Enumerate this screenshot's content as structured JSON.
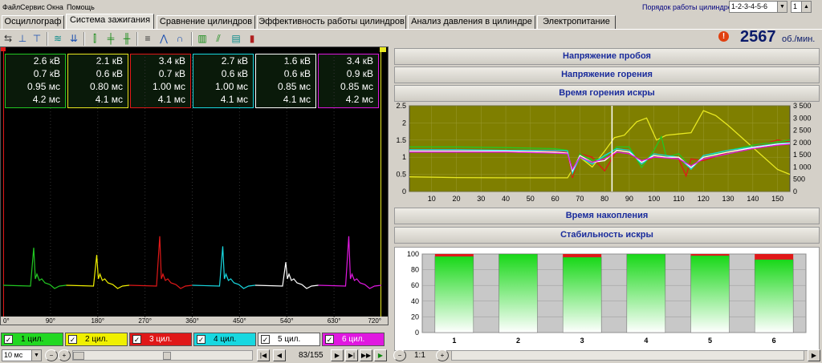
{
  "menu": [
    "Файл",
    "Сервис",
    "Окна",
    "Помощь"
  ],
  "firing_order": {
    "label": "Порядок работы цилиндров",
    "value": "1-2-3-4-5-6",
    "index": "1"
  },
  "tabs": [
    "Осциллограф",
    "Система зажигания",
    "Сравнение цилиндров",
    "Эффективность работы цилиндров",
    "Анализ давления в цилиндре",
    "Электропитание"
  ],
  "rpm": {
    "value": "2567",
    "unit": "об./мин."
  },
  "cylinders": [
    {
      "kv1": "2.6 кВ",
      "kv2": "0.7 кВ",
      "ms1": "0.95 мс",
      "ms2": "4.2 мс",
      "label": "1 цил.",
      "color": "#22c822"
    },
    {
      "kv1": "2.1 кВ",
      "kv2": "0.6 кВ",
      "ms1": "0.80 мс",
      "ms2": "4.1 мс",
      "label": "2 цил.",
      "color": "#f0f000"
    },
    {
      "kv1": "3.4 кВ",
      "kv2": "0.7 кВ",
      "ms1": "1.00 мс",
      "ms2": "4.1 мс",
      "label": "3 цил.",
      "color": "#e01818"
    },
    {
      "kv1": "2.7 кВ",
      "kv2": "0.6 кВ",
      "ms1": "1.00 мс",
      "ms2": "4.1 мс",
      "label": "4 цил.",
      "color": "#18d8e0"
    },
    {
      "kv1": "1.6 кВ",
      "kv2": "0.6 кВ",
      "ms1": "0.85 мс",
      "ms2": "4.1 мс",
      "label": "5 цил.",
      "color": "#ffffff"
    },
    {
      "kv1": "3.4 кВ",
      "kv2": "0.9 кВ",
      "ms1": "0.85 мс",
      "ms2": "4.2 мс",
      "label": "6 цил.",
      "color": "#e018e0"
    }
  ],
  "scope_axis": [
    "0°",
    "90°",
    "180°",
    "270°",
    "360°",
    "450°",
    "540°",
    "630°",
    "720°"
  ],
  "timebase": "10 мс",
  "frame": "83/155",
  "sections": [
    "Напряжение пробоя",
    "Напряжение горения",
    "Время горения искры",
    "Время накопления",
    "Стабильность искры"
  ],
  "zoom": "1:1",
  "chart_data": [
    {
      "type": "line",
      "y_left_ticks": [
        "0",
        "0.5",
        "1",
        "1.5",
        "2",
        "2.5"
      ],
      "y_right_ticks": [
        "0",
        "500",
        "1 000",
        "1 500",
        "2 000",
        "2 500",
        "3 000",
        "3 500"
      ],
      "x_ticks": [
        "10",
        "20",
        "30",
        "40",
        "50",
        "60",
        "70",
        "80",
        "90",
        "100",
        "110",
        "120",
        "130",
        "140",
        "150"
      ],
      "xlim": [
        1,
        155
      ],
      "ylim_left": [
        0,
        2.5
      ],
      "ylim_right": [
        0,
        3500
      ],
      "cursor_x": 83,
      "series": [
        {
          "color": "#e8e820",
          "axis": "right",
          "x": [
            1,
            20,
            40,
            60,
            65,
            70,
            75,
            80,
            84,
            88,
            93,
            97,
            101,
            105,
            110,
            115,
            120,
            125,
            130,
            140,
            150,
            155
          ],
          "y": [
            600,
            570,
            560,
            560,
            560,
            1400,
            1000,
            1650,
            2200,
            2300,
            2850,
            3000,
            2100,
            2300,
            2350,
            2400,
            3300,
            3100,
            2700,
            1800,
            900,
            700
          ]
        },
        {
          "color": "#e01818",
          "axis": "left",
          "x": [
            1,
            20,
            40,
            60,
            65,
            67,
            70,
            75,
            80,
            85,
            90,
            95,
            100,
            105,
            110,
            113,
            115,
            120,
            130,
            140,
            150,
            155
          ],
          "y": [
            1.2,
            1.2,
            1.2,
            1.18,
            1.15,
            0.4,
            1.1,
            1.0,
            0.6,
            1.2,
            1.15,
            0.85,
            1.0,
            1.0,
            0.95,
            0.45,
            0.95,
            0.9,
            1.15,
            1.3,
            1.5,
            1.45
          ]
        },
        {
          "color": "#22c822",
          "axis": "left",
          "x": [
            1,
            20,
            40,
            60,
            65,
            67,
            70,
            75,
            80,
            85,
            90,
            95,
            100,
            103,
            105,
            110,
            115,
            120,
            130,
            140,
            150,
            155
          ],
          "y": [
            1.3,
            1.3,
            1.28,
            1.25,
            1.2,
            0.5,
            1.1,
            0.9,
            1.0,
            1.3,
            1.3,
            0.7,
            1.2,
            1.6,
            1.0,
            1.1,
            0.7,
            1.0,
            1.2,
            1.35,
            1.45,
            1.5
          ]
        },
        {
          "color": "#18d8e0",
          "axis": "left",
          "x": [
            1,
            20,
            40,
            60,
            65,
            67,
            70,
            75,
            80,
            85,
            90,
            95,
            100,
            105,
            110,
            115,
            120,
            130,
            140,
            150,
            155
          ],
          "y": [
            1.22,
            1.22,
            1.2,
            1.2,
            1.18,
            0.55,
            1.0,
            0.8,
            1.05,
            1.25,
            1.2,
            0.8,
            1.1,
            1.05,
            1.0,
            0.65,
            1.05,
            1.2,
            1.3,
            1.4,
            1.42
          ]
        },
        {
          "color": "#ffffff",
          "axis": "left",
          "x": [
            1,
            20,
            40,
            60,
            65,
            67,
            70,
            75,
            80,
            85,
            90,
            95,
            100,
            105,
            110,
            115,
            120,
            130,
            140,
            150,
            155
          ],
          "y": [
            1.18,
            1.18,
            1.18,
            1.15,
            1.12,
            0.6,
            1.05,
            0.85,
            0.9,
            1.2,
            1.15,
            0.85,
            1.05,
            1.0,
            1.0,
            0.7,
            1.0,
            1.15,
            1.28,
            1.38,
            1.4
          ]
        },
        {
          "color": "#e018e0",
          "axis": "left",
          "x": [
            1,
            20,
            40,
            60,
            65,
            67,
            70,
            75,
            80,
            85,
            90,
            95,
            100,
            105,
            110,
            115,
            120,
            130,
            140,
            150,
            155
          ],
          "y": [
            1.15,
            1.15,
            1.15,
            1.12,
            1.1,
            0.65,
            1.0,
            0.85,
            0.95,
            1.15,
            1.1,
            0.9,
            1.0,
            0.98,
            0.95,
            0.75,
            0.95,
            1.1,
            1.25,
            1.35,
            1.38
          ]
        }
      ]
    },
    {
      "type": "bar",
      "categories": [
        "1",
        "2",
        "3",
        "4",
        "5",
        "6"
      ],
      "y_ticks": [
        "0",
        "20",
        "40",
        "60",
        "80",
        "100"
      ],
      "ylim": [
        0,
        100
      ],
      "series": [
        {
          "color": "#22d822",
          "values": [
            97,
            100,
            96,
            100,
            98,
            93
          ]
        },
        {
          "color": "#e01818",
          "values": [
            3,
            0,
            4,
            0,
            2,
            7
          ]
        }
      ]
    }
  ]
}
